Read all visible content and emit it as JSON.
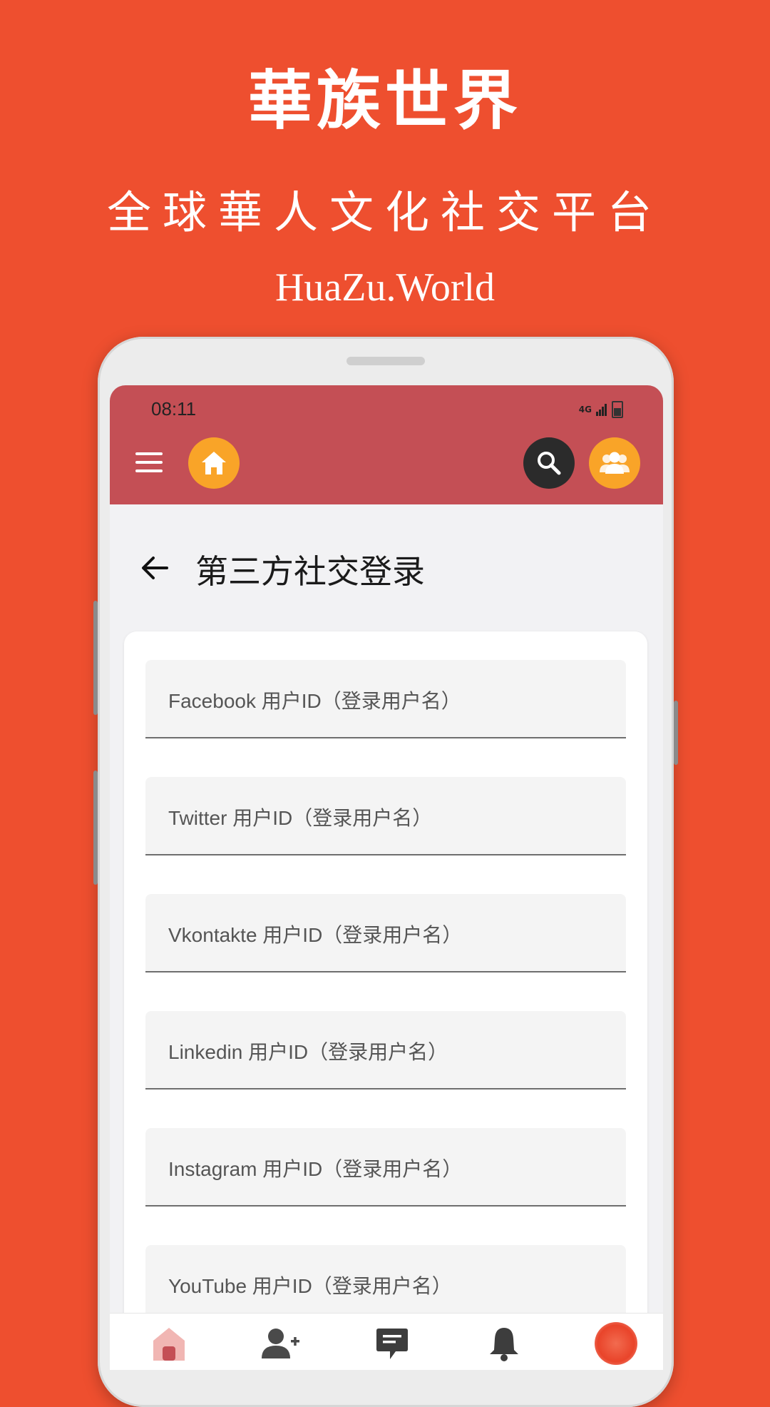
{
  "promo": {
    "title": "華族世界",
    "subtitle": "全球華人文化社交平台",
    "url": "HuaZu.World"
  },
  "status_bar": {
    "time": "08:11",
    "network": "4G"
  },
  "app_bar": {
    "icons": [
      "menu-icon",
      "home-icon",
      "search-icon",
      "group-icon"
    ],
    "colors": {
      "bar": "#c44f55",
      "accent": "#f9a428",
      "search": "#2b2b2b"
    }
  },
  "page": {
    "title": "第三方社交登录"
  },
  "fields": [
    {
      "label": "Facebook 用户ID（登录用户名）"
    },
    {
      "label": "Twitter 用户ID（登录用户名）"
    },
    {
      "label": "Vkontakte 用户ID（登录用户名）"
    },
    {
      "label": "Linkedin 用户ID（登录用户名）"
    },
    {
      "label": "Instagram 用户ID（登录用户名）"
    },
    {
      "label": "YouTube 用户ID（登录用户名）"
    }
  ],
  "bottom_nav": {
    "icons": [
      "home-icon",
      "add-user-icon",
      "chat-icon",
      "bell-icon",
      "avatar"
    ]
  },
  "background_color": "#ee4f2f"
}
